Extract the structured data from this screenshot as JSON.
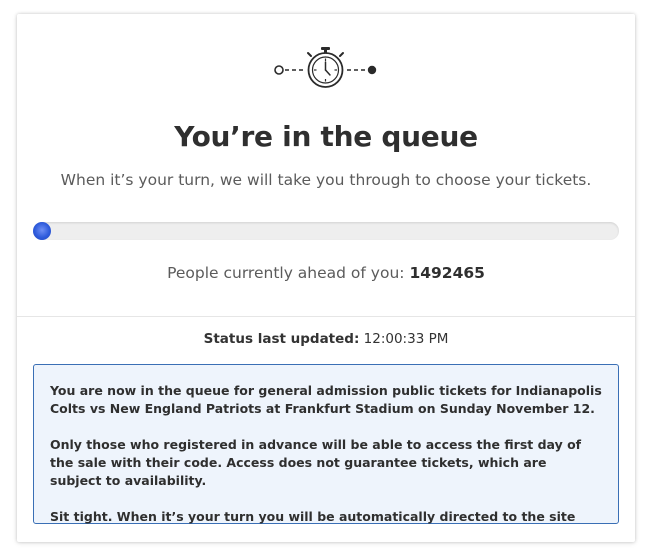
{
  "queue": {
    "title": "You’re in the queue",
    "subtitle": "When it’s your turn, we will take you through to choose your tickets.",
    "progress_fraction": 0.0,
    "ahead_label": "People currently ahead of you:",
    "ahead_count": "1492465",
    "icon": "stopwatch-icon"
  },
  "status": {
    "label": "Status last updated:",
    "time": "12:00:33 PM"
  },
  "info": {
    "paragraph1": "You are now in the queue for general admission public tickets for Indianapolis Colts vs New England Patriots at Frankfurt Stadium on Sunday November 12.",
    "paragraph2": "Only those who registered in advance will be able to access the first day of the sale with their code. Access does not guarantee tickets, which are subject to availability.",
    "paragraph3": "Sit tight. When it’s your turn you will be automatically directed to the site"
  },
  "colors": {
    "progress": "#2e5bdb",
    "info_border": "#3a6fb5",
    "info_background": "#eef4fc",
    "text_dark": "#2f2f2f"
  }
}
